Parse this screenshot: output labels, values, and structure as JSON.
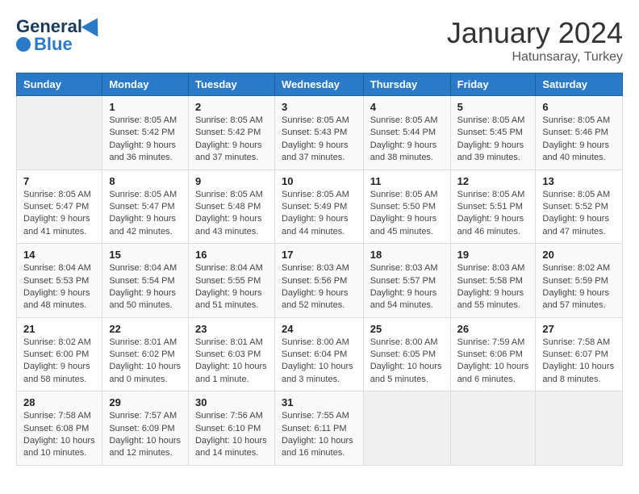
{
  "logo": {
    "general": "General",
    "blue": "Blue"
  },
  "header": {
    "month": "January 2024",
    "location": "Hatunsaray, Turkey"
  },
  "weekdays": [
    "Sunday",
    "Monday",
    "Tuesday",
    "Wednesday",
    "Thursday",
    "Friday",
    "Saturday"
  ],
  "weeks": [
    [
      {
        "day": "",
        "sunrise": "",
        "sunset": "",
        "daylight": ""
      },
      {
        "day": "1",
        "sunrise": "Sunrise: 8:05 AM",
        "sunset": "Sunset: 5:42 PM",
        "daylight": "Daylight: 9 hours and 36 minutes."
      },
      {
        "day": "2",
        "sunrise": "Sunrise: 8:05 AM",
        "sunset": "Sunset: 5:42 PM",
        "daylight": "Daylight: 9 hours and 37 minutes."
      },
      {
        "day": "3",
        "sunrise": "Sunrise: 8:05 AM",
        "sunset": "Sunset: 5:43 PM",
        "daylight": "Daylight: 9 hours and 37 minutes."
      },
      {
        "day": "4",
        "sunrise": "Sunrise: 8:05 AM",
        "sunset": "Sunset: 5:44 PM",
        "daylight": "Daylight: 9 hours and 38 minutes."
      },
      {
        "day": "5",
        "sunrise": "Sunrise: 8:05 AM",
        "sunset": "Sunset: 5:45 PM",
        "daylight": "Daylight: 9 hours and 39 minutes."
      },
      {
        "day": "6",
        "sunrise": "Sunrise: 8:05 AM",
        "sunset": "Sunset: 5:46 PM",
        "daylight": "Daylight: 9 hours and 40 minutes."
      }
    ],
    [
      {
        "day": "7",
        "sunrise": "Sunrise: 8:05 AM",
        "sunset": "Sunset: 5:47 PM",
        "daylight": "Daylight: 9 hours and 41 minutes."
      },
      {
        "day": "8",
        "sunrise": "Sunrise: 8:05 AM",
        "sunset": "Sunset: 5:47 PM",
        "daylight": "Daylight: 9 hours and 42 minutes."
      },
      {
        "day": "9",
        "sunrise": "Sunrise: 8:05 AM",
        "sunset": "Sunset: 5:48 PM",
        "daylight": "Daylight: 9 hours and 43 minutes."
      },
      {
        "day": "10",
        "sunrise": "Sunrise: 8:05 AM",
        "sunset": "Sunset: 5:49 PM",
        "daylight": "Daylight: 9 hours and 44 minutes."
      },
      {
        "day": "11",
        "sunrise": "Sunrise: 8:05 AM",
        "sunset": "Sunset: 5:50 PM",
        "daylight": "Daylight: 9 hours and 45 minutes."
      },
      {
        "day": "12",
        "sunrise": "Sunrise: 8:05 AM",
        "sunset": "Sunset: 5:51 PM",
        "daylight": "Daylight: 9 hours and 46 minutes."
      },
      {
        "day": "13",
        "sunrise": "Sunrise: 8:05 AM",
        "sunset": "Sunset: 5:52 PM",
        "daylight": "Daylight: 9 hours and 47 minutes."
      }
    ],
    [
      {
        "day": "14",
        "sunrise": "Sunrise: 8:04 AM",
        "sunset": "Sunset: 5:53 PM",
        "daylight": "Daylight: 9 hours and 48 minutes."
      },
      {
        "day": "15",
        "sunrise": "Sunrise: 8:04 AM",
        "sunset": "Sunset: 5:54 PM",
        "daylight": "Daylight: 9 hours and 50 minutes."
      },
      {
        "day": "16",
        "sunrise": "Sunrise: 8:04 AM",
        "sunset": "Sunset: 5:55 PM",
        "daylight": "Daylight: 9 hours and 51 minutes."
      },
      {
        "day": "17",
        "sunrise": "Sunrise: 8:03 AM",
        "sunset": "Sunset: 5:56 PM",
        "daylight": "Daylight: 9 hours and 52 minutes."
      },
      {
        "day": "18",
        "sunrise": "Sunrise: 8:03 AM",
        "sunset": "Sunset: 5:57 PM",
        "daylight": "Daylight: 9 hours and 54 minutes."
      },
      {
        "day": "19",
        "sunrise": "Sunrise: 8:03 AM",
        "sunset": "Sunset: 5:58 PM",
        "daylight": "Daylight: 9 hours and 55 minutes."
      },
      {
        "day": "20",
        "sunrise": "Sunrise: 8:02 AM",
        "sunset": "Sunset: 5:59 PM",
        "daylight": "Daylight: 9 hours and 57 minutes."
      }
    ],
    [
      {
        "day": "21",
        "sunrise": "Sunrise: 8:02 AM",
        "sunset": "Sunset: 6:00 PM",
        "daylight": "Daylight: 9 hours and 58 minutes."
      },
      {
        "day": "22",
        "sunrise": "Sunrise: 8:01 AM",
        "sunset": "Sunset: 6:02 PM",
        "daylight": "Daylight: 10 hours and 0 minutes."
      },
      {
        "day": "23",
        "sunrise": "Sunrise: 8:01 AM",
        "sunset": "Sunset: 6:03 PM",
        "daylight": "Daylight: 10 hours and 1 minute."
      },
      {
        "day": "24",
        "sunrise": "Sunrise: 8:00 AM",
        "sunset": "Sunset: 6:04 PM",
        "daylight": "Daylight: 10 hours and 3 minutes."
      },
      {
        "day": "25",
        "sunrise": "Sunrise: 8:00 AM",
        "sunset": "Sunset: 6:05 PM",
        "daylight": "Daylight: 10 hours and 5 minutes."
      },
      {
        "day": "26",
        "sunrise": "Sunrise: 7:59 AM",
        "sunset": "Sunset: 6:06 PM",
        "daylight": "Daylight: 10 hours and 6 minutes."
      },
      {
        "day": "27",
        "sunrise": "Sunrise: 7:58 AM",
        "sunset": "Sunset: 6:07 PM",
        "daylight": "Daylight: 10 hours and 8 minutes."
      }
    ],
    [
      {
        "day": "28",
        "sunrise": "Sunrise: 7:58 AM",
        "sunset": "Sunset: 6:08 PM",
        "daylight": "Daylight: 10 hours and 10 minutes."
      },
      {
        "day": "29",
        "sunrise": "Sunrise: 7:57 AM",
        "sunset": "Sunset: 6:09 PM",
        "daylight": "Daylight: 10 hours and 12 minutes."
      },
      {
        "day": "30",
        "sunrise": "Sunrise: 7:56 AM",
        "sunset": "Sunset: 6:10 PM",
        "daylight": "Daylight: 10 hours and 14 minutes."
      },
      {
        "day": "31",
        "sunrise": "Sunrise: 7:55 AM",
        "sunset": "Sunset: 6:11 PM",
        "daylight": "Daylight: 10 hours and 16 minutes."
      },
      {
        "day": "",
        "sunrise": "",
        "sunset": "",
        "daylight": ""
      },
      {
        "day": "",
        "sunrise": "",
        "sunset": "",
        "daylight": ""
      },
      {
        "day": "",
        "sunrise": "",
        "sunset": "",
        "daylight": ""
      }
    ]
  ]
}
